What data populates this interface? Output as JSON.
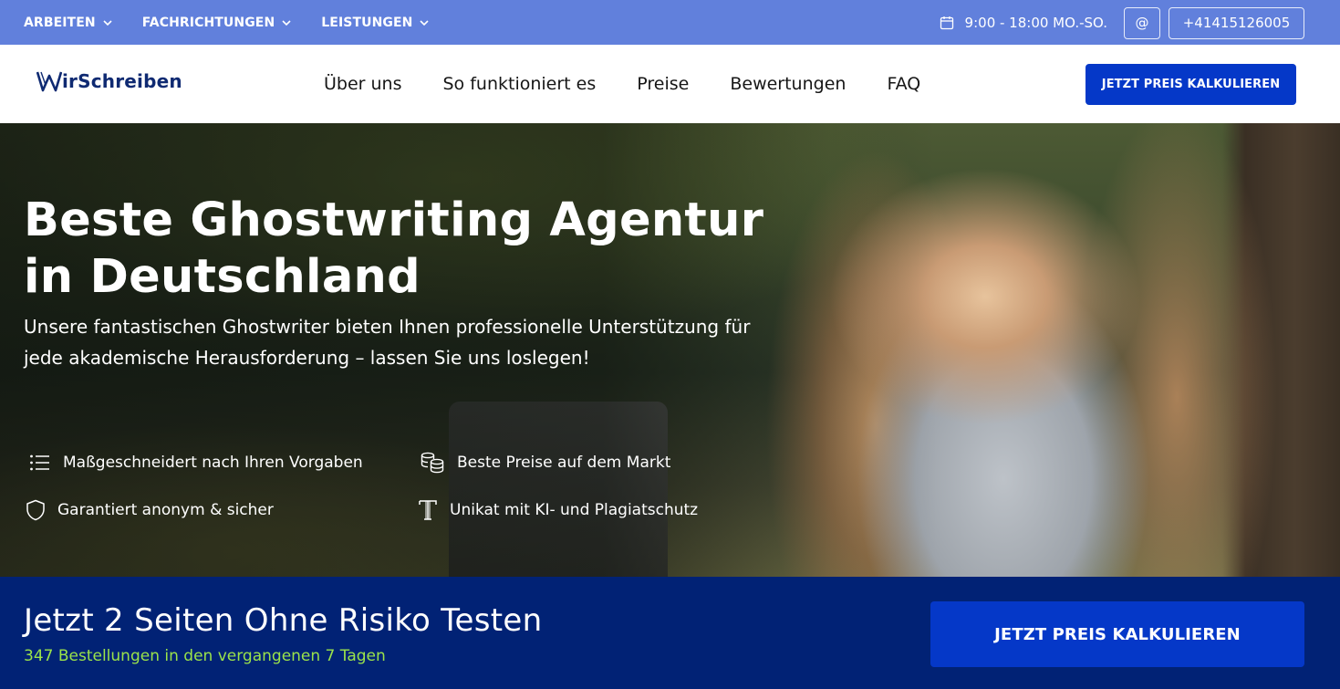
{
  "topbar": {
    "nav": [
      {
        "label": "ARBEITEN"
      },
      {
        "label": "FACHRICHTUNGEN"
      },
      {
        "label": "LEISTUNGEN"
      }
    ],
    "hours": "9:00 - 18:00 MO.-SO.",
    "email_symbol": "@",
    "phone": "+41415126005",
    "icons": {
      "hours": "calendar-icon",
      "nav_dropdown": "chevron-down-icon"
    }
  },
  "header": {
    "logo_text": "irSchreiben",
    "logo_icon": "w-logo-icon",
    "nav": [
      {
        "label": "Über uns"
      },
      {
        "label": "So funktioniert es"
      },
      {
        "label": "Preise"
      },
      {
        "label": "Bewertungen"
      },
      {
        "label": "FAQ"
      }
    ],
    "cta_label": "JETZT PREIS KALKULIEREN"
  },
  "hero": {
    "title": "Beste Ghostwriting Agentur in Deutschland",
    "subtitle": "Unsere fantastischen Ghostwriter bieten Ihnen professionelle Unterstützung für jede akademische Herausforderung – lassen Sie uns loslegen!",
    "features": [
      {
        "label": "Maßgeschneidert nach Ihren Vorgaben",
        "icon": "list-icon"
      },
      {
        "label": "Beste Preise auf dem Markt",
        "icon": "coins-icon"
      },
      {
        "label": "Garantiert anonym & sicher",
        "icon": "shield-icon"
      },
      {
        "label": "Unikat mit KI- und Plagiatschutz",
        "icon": "text-icon"
      }
    ]
  },
  "banner": {
    "title": "Jetzt 2 Seiten Ohne Risiko Testen",
    "subtitle": "347 Bestellungen in den vergangenen 7 Tagen",
    "cta_label": "JETZT PREIS KALKULIEREN"
  },
  "colors": {
    "topbar": "#6180dc",
    "primary": "#0538c8",
    "banner": "#012275",
    "highlight": "#9be34a",
    "logo": "#0f2a72"
  }
}
